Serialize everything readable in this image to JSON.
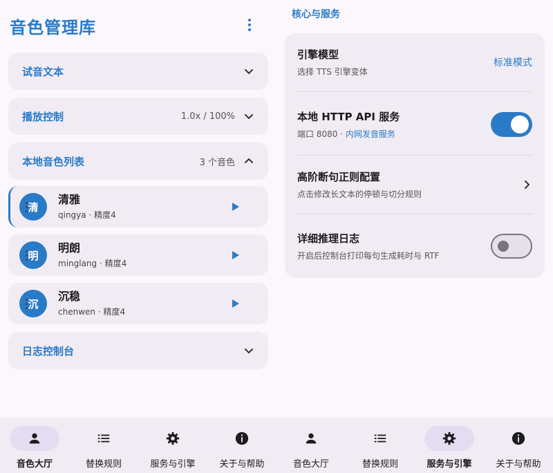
{
  "left": {
    "app_title": "音色管理库",
    "sections": {
      "sample_text": {
        "label": "试音文本"
      },
      "playback": {
        "label": "播放控制",
        "meta": "1.0x / 100%"
      },
      "voices": {
        "label": "本地音色列表",
        "meta": "3 个音色"
      },
      "log": {
        "label": "日志控制台"
      }
    },
    "voices": [
      {
        "avatar": "清",
        "name": "清雅",
        "sub": "qingya · 精度4"
      },
      {
        "avatar": "明",
        "name": "明朗",
        "sub": "minglang · 精度4"
      },
      {
        "avatar": "沉",
        "name": "沉稳",
        "sub": "chenwen · 精度4"
      }
    ]
  },
  "right": {
    "group_title": "核心与服务",
    "engine": {
      "title": "引擎模型",
      "desc": "选择 TTS 引擎变体",
      "value": "标准模式"
    },
    "http": {
      "title": "本地 HTTP API 服务",
      "desc_prefix": "端口 8080 · ",
      "desc_link": "内网发音服务",
      "enabled": true
    },
    "regex": {
      "title": "高阶断句正则配置",
      "desc": "点击修改长文本的停顿与切分规则"
    },
    "log": {
      "title": "详细推理日志",
      "desc": "开启后控制台打印每句生成耗时与 RTF",
      "enabled": false
    }
  },
  "nav_left": [
    {
      "label": "音色大厅",
      "icon": "person-icon",
      "active": true
    },
    {
      "label": "替换规则",
      "icon": "list-icon",
      "active": false
    },
    {
      "label": "服务与引擎",
      "icon": "gear-icon",
      "active": false
    },
    {
      "label": "关于与帮助",
      "icon": "info-icon",
      "active": false
    }
  ],
  "nav_right": [
    {
      "label": "音色大厅",
      "icon": "person-icon",
      "active": false
    },
    {
      "label": "替换规则",
      "icon": "list-icon",
      "active": false
    },
    {
      "label": "服务与引擎",
      "icon": "gear-icon",
      "active": true
    },
    {
      "label": "关于与帮助",
      "icon": "info-icon",
      "active": false
    }
  ],
  "colors": {
    "accent": "#2a7bc7",
    "surface": "#f1ecf3",
    "background": "#fcf7fc",
    "nav_active": "#e4dcf0"
  }
}
